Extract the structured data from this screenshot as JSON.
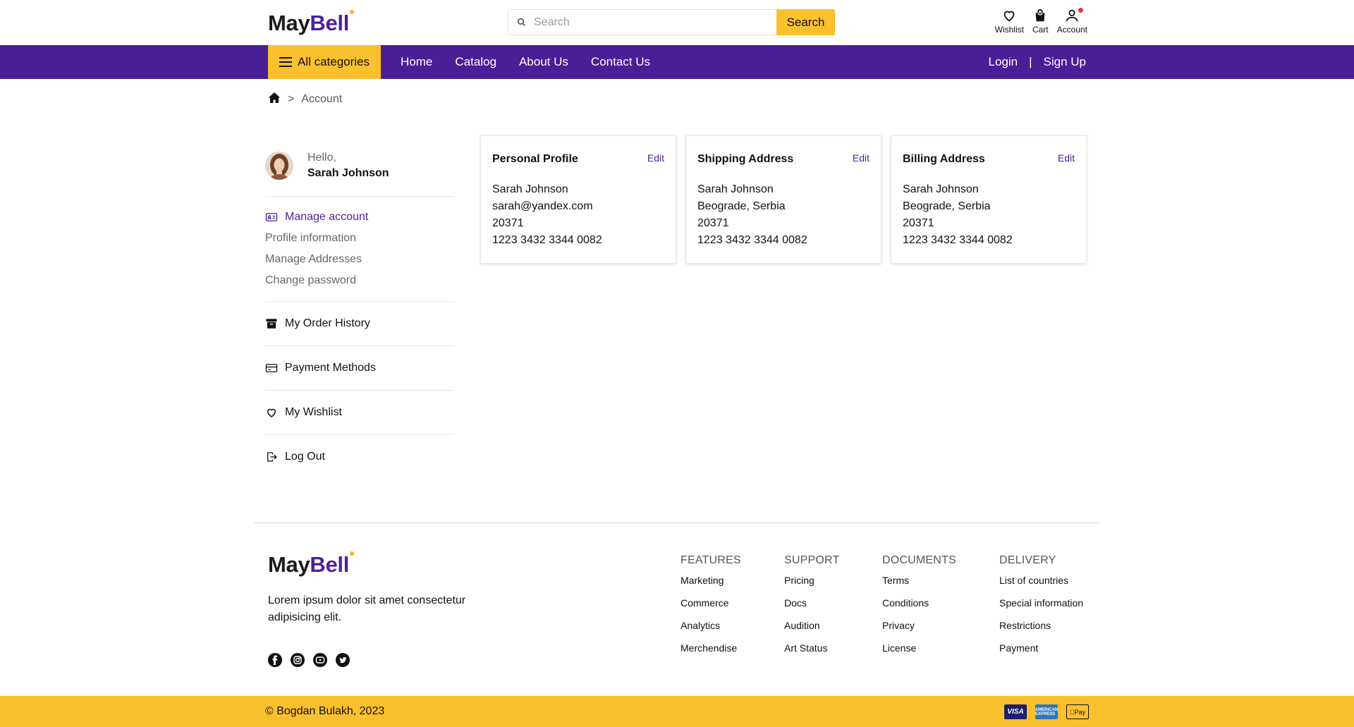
{
  "brand": {
    "name_part1": "May",
    "name_part2": "Bell",
    "primary_color": "#4a1e96",
    "accent_color": "#fbc02d"
  },
  "search": {
    "placeholder": "Search",
    "button_label": "Search"
  },
  "top_icons": [
    {
      "label": "Wishlist",
      "icon": "heart-icon"
    },
    {
      "label": "Cart",
      "icon": "shopping-bag-icon"
    },
    {
      "label": "Account",
      "icon": "user-icon"
    }
  ],
  "nav": {
    "categories_label": "All categories",
    "links": [
      "Home",
      "Catalog",
      "About Us",
      "Contact Us"
    ],
    "login": "Login",
    "separator": "|",
    "signup": "Sign Up"
  },
  "breadcrumb": {
    "separator": ">",
    "current": "Account"
  },
  "user": {
    "greeting": "Hello,",
    "name": "Sarah Johnson"
  },
  "sidebar": {
    "manage_account": "Manage account",
    "sub_items": [
      "Profile information",
      "Manage Addresses",
      "Change password"
    ],
    "order_history": "My Order History",
    "payment_methods": "Payment Methods",
    "wishlist": "My Wishlist",
    "logout": "Log Out"
  },
  "cards": [
    {
      "title": "Personal Profile",
      "edit": "Edit",
      "lines": [
        "Sarah Johnson",
        "sarah@yandex.com",
        "20371",
        "1223 3432 3344 0082"
      ]
    },
    {
      "title": "Shipping Address",
      "edit": "Edit",
      "lines": [
        "Sarah Johnson",
        "Beograde, Serbia",
        "20371",
        "1223 3432 3344 0082"
      ]
    },
    {
      "title": "Billing Address",
      "edit": "Edit",
      "lines": [
        "Sarah Johnson",
        "Beograde, Serbia",
        "20371",
        "1223 3432 3344 0082"
      ]
    }
  ],
  "footer": {
    "description": "Lorem ipsum dolor sit amet consectetur adipisicing elit.",
    "socials": [
      "facebook-icon",
      "instagram-icon",
      "youtube-icon",
      "twitter-icon"
    ],
    "columns": [
      {
        "heading": "FEATURES",
        "links": [
          "Marketing",
          "Commerce",
          "Analytics",
          "Merchendise"
        ]
      },
      {
        "heading": "SUPPORT",
        "links": [
          "Pricing",
          "Docs",
          "Audition",
          "Art Status"
        ]
      },
      {
        "heading": "DOCUMENTS",
        "links": [
          "Terms",
          "Conditions",
          "Privacy",
          "License"
        ]
      },
      {
        "heading": "DELIVERY",
        "links": [
          "List of countries",
          "Special information",
          "Restrictions",
          "Payment"
        ]
      }
    ],
    "copyright": "© Bogdan Bulakh, 2023",
    "payment_icons": [
      "VISA",
      "AMERICAN EXPRESS",
      "Pay"
    ]
  }
}
